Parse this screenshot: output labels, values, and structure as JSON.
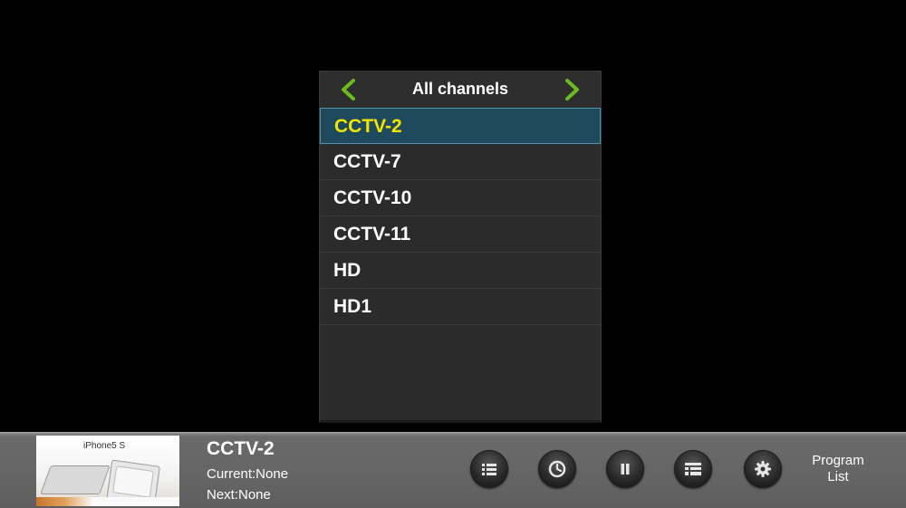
{
  "panel": {
    "title": "All channels"
  },
  "channels": [
    {
      "label": "CCTV-2",
      "selected": true
    },
    {
      "label": "CCTV-7",
      "selected": false
    },
    {
      "label": "CCTV-10",
      "selected": false
    },
    {
      "label": "CCTV-11",
      "selected": false
    },
    {
      "label": "HD",
      "selected": false
    },
    {
      "label": "HD1",
      "selected": false
    }
  ],
  "info_bar": {
    "thumbnail_brand": "iPhone5 S",
    "channel_name": "CCTV-2",
    "current": "Current:None",
    "next": "Next:None",
    "program_list_line1": "Program",
    "program_list_line2": "List"
  },
  "colors": {
    "accent_arrow": "#6bbd1f",
    "selected_text": "#f2e500",
    "selected_bg": "#1f4a5e"
  },
  "icons": {
    "prev": "chevron-left-icon",
    "next": "chevron-right-icon",
    "buttons": [
      "list-icon",
      "clock-icon",
      "pause-icon",
      "epg-list-icon",
      "gear-icon"
    ]
  }
}
